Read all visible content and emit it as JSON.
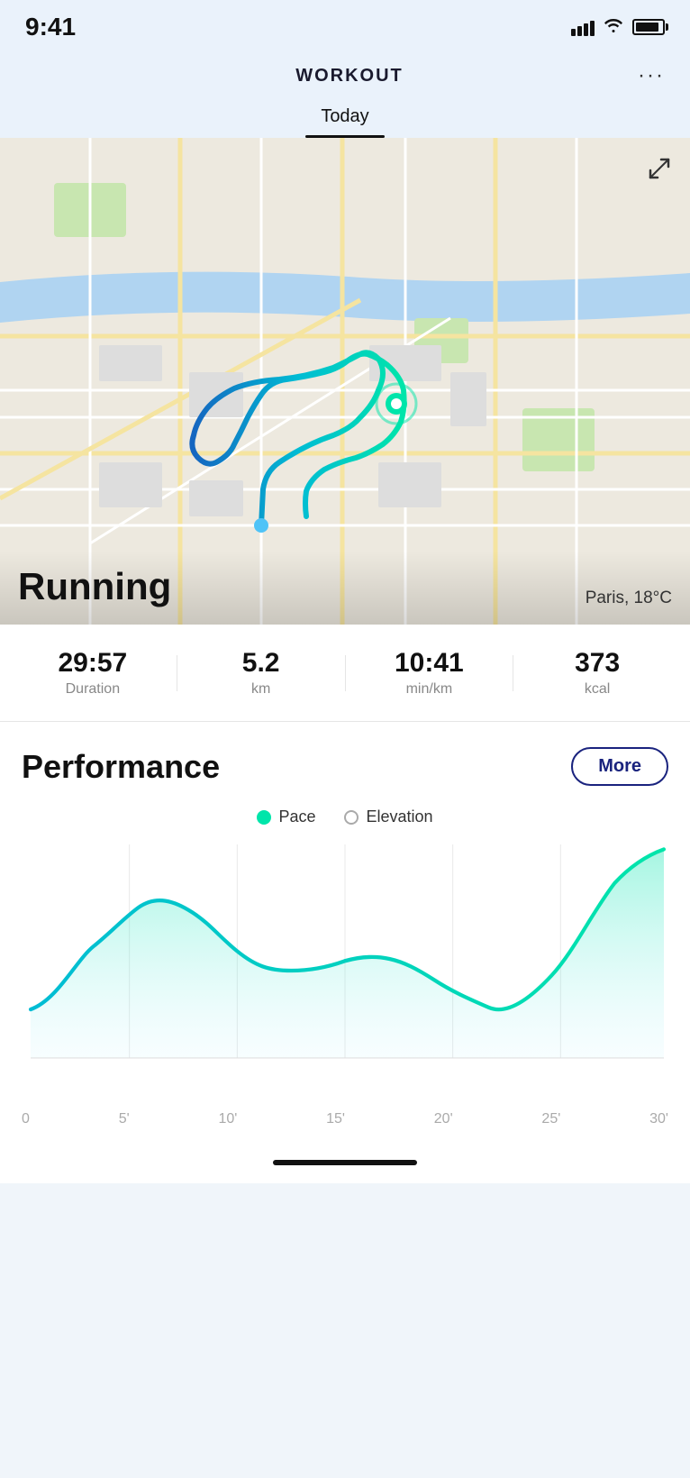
{
  "statusBar": {
    "time": "9:41",
    "signalBars": [
      8,
      11,
      14,
      17
    ],
    "icons": [
      "signal",
      "wifi",
      "battery"
    ]
  },
  "header": {
    "title": "WORKOUT",
    "moreLabel": "···"
  },
  "tabs": [
    {
      "label": "Today",
      "active": true
    }
  ],
  "map": {
    "activityType": "Running",
    "location": "Paris, 18°C",
    "expandIcon": "↗↙"
  },
  "stats": [
    {
      "value": "29:57",
      "label": "Duration"
    },
    {
      "value": "5.2",
      "label": "km"
    },
    {
      "value": "10:41",
      "label": "min/km"
    },
    {
      "value": "373",
      "label": "kcal"
    }
  ],
  "performance": {
    "title": "Performance",
    "moreButton": "More",
    "legend": [
      {
        "label": "Pace",
        "type": "filled"
      },
      {
        "label": "Elevation",
        "type": "empty"
      }
    ]
  },
  "chart": {
    "xLabels": [
      "0",
      "5'",
      "10'",
      "15'",
      "20'",
      "25'",
      "30'"
    ]
  }
}
